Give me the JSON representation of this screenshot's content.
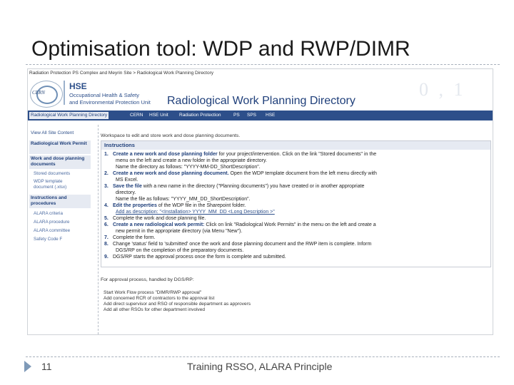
{
  "slide": {
    "title": "Optimisation tool: WDP and RWP/DIMR",
    "page_number": "11",
    "footer": "Training RSSO,  ALARA Principle"
  },
  "screenshot": {
    "breadcrumb": "Radiation Protection PS Complex and Meyrin Site > Radiological Work Planning Directory",
    "hse_title": "HSE",
    "hse_sub1": "Occupational Health & Safety",
    "hse_sub2": "and Environmental Protection Unit",
    "page_title": "Radiological Work Planning Directory",
    "banner_deco": "0 , 1",
    "logo_text": "CERN",
    "topnav": [
      "Radiological Work Planning Directory",
      "CERN",
      "HSE Unit",
      "Radiation Protection",
      "PS",
      "SPS",
      "HSE"
    ],
    "leftnav": {
      "view_all": "View All Site Content",
      "section1": "Radiological Work Permit",
      "section2": "Work and dose planning documents",
      "section2_items": [
        "Stored documents",
        "WDP template",
        "document (.xlsx)"
      ],
      "section3": "Instructions and procedures",
      "section3_items": [
        "ALARA criteria",
        "ALARA procedure",
        "ALARA committee",
        "Safety Code F"
      ]
    },
    "workspace_text": "Workspace to edit and store work and dose planning documents.",
    "instructions_heading": "Instructions",
    "steps": [
      {
        "n": "1.",
        "bold": "Create a new work and dose planning folder",
        "rest": " for your project/intervention. Click on the link \"Stored documents\" in the"
      },
      {
        "n": "2.",
        "bold": "Create a new work and dose planning document.",
        "rest": " Open the WDP template document from the left menu directly with"
      },
      {
        "n": "3.",
        "bold": "Save the file",
        "rest": " with a new name in the directory (\"Planning documents\") you have created or in another appropriate"
      },
      {
        "n": "4.",
        "bold": "Edit the properties",
        "rest": " of the WDP file in the Sharepoint folder."
      },
      {
        "n": "5.",
        "bold": "",
        "rest": "Complete the work and dose planning file."
      },
      {
        "n": "6.",
        "bold": "Create a new radiological work permit:",
        "rest": " Click on link \"Radiological Work Permits\" in the menu on the left and create a"
      },
      {
        "n": "7.",
        "bold": "",
        "rest": "Complete the form."
      },
      {
        "n": "8.",
        "bold": "",
        "rest": "Change 'status' field to 'submitted' once the work and dose planning document and the RWP item is complete. Inform"
      },
      {
        "n": "9.",
        "bold": "",
        "rest": "DGS/RP starts the approval process once the form is complete and submitted."
      }
    ],
    "continuations": [
      "menu on the left and create a new folder in the appropriate directory.",
      "Name the directory as follows: \"YYYY-MM-DD_ShortDescription\".",
      "MS Excel.",
      "directory.",
      "Name the file as follows: \"YYYY_MM_DD_ShortDescription\".",
      "Add as description: \"<Installation> YYYY_MM_DD <Long Description >\"",
      "new permit in the appropriate directory (via Menu \"New\").",
      "DGS/RP on the completion of the preparatory documents."
    ],
    "process_text": "For approval process, handled by DGS/RP:",
    "process_items": [
      "Start Work Flow process \"DIMR/RWP approval\"",
      "Add concerned RCR of contractors to the approval list",
      "Add direct supervisor and RSO of responsible department as approvers",
      "Add all other RSOs for other department involved"
    ]
  }
}
